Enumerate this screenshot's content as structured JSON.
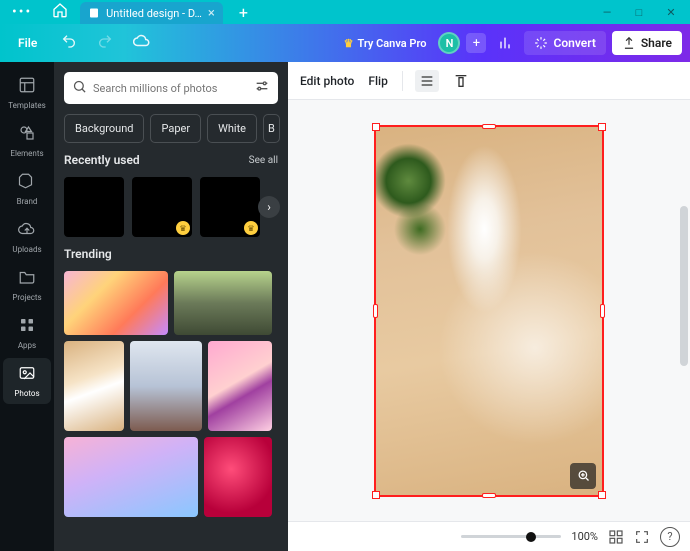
{
  "window": {
    "tab_title": "Untitled design - D…",
    "minimize": "—",
    "maximize": "□",
    "close": "✕"
  },
  "topbar": {
    "file": "File",
    "try_pro": "Try Canva Pro",
    "avatar_initial": "N",
    "convert": "Convert",
    "share": "Share"
  },
  "rail": {
    "items": [
      {
        "label": "Templates"
      },
      {
        "label": "Elements"
      },
      {
        "label": "Brand"
      },
      {
        "label": "Uploads"
      },
      {
        "label": "Projects"
      },
      {
        "label": "Apps"
      },
      {
        "label": "Photos"
      }
    ]
  },
  "panel": {
    "search_placeholder": "Search millions of photos",
    "chips": {
      "background": "Background",
      "paper": "Paper",
      "white": "White"
    },
    "recently_used": "Recently used",
    "see_all": "See all",
    "trending": "Trending"
  },
  "context_toolbar": {
    "edit_photo": "Edit photo",
    "flip": "Flip"
  },
  "bottom": {
    "zoom": "100%"
  }
}
